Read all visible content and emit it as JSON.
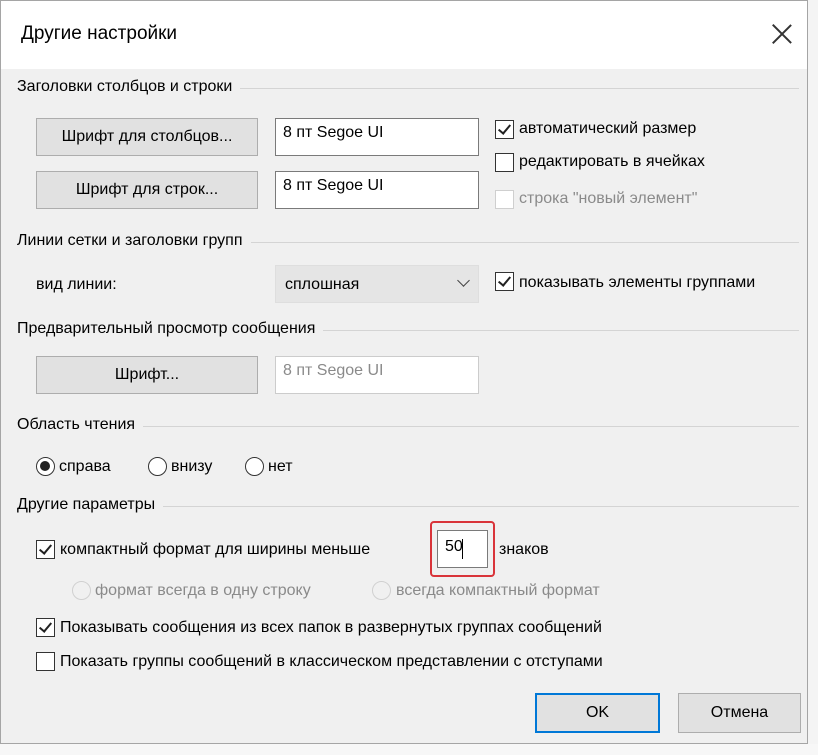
{
  "dialog": {
    "title": "Другие настройки",
    "close_icon": "close-icon"
  },
  "headers_group": {
    "label": "Заголовки столбцов и строки",
    "column_font_button": "Шрифт для столбцов...",
    "column_font_value": "8 пт Segoe UI",
    "row_font_button": "Шрифт для строк...",
    "row_font_value": "8 пт Segoe UI",
    "auto_size": {
      "label": "автоматический размер",
      "checked": true
    },
    "edit_in_cells": {
      "label": "редактировать в ячейках",
      "checked": false
    },
    "new_item_row": {
      "label": "строка \"новый элемент\"",
      "checked": false,
      "disabled": true
    }
  },
  "grid_group": {
    "label": "Линии сетки и заголовки групп",
    "line_style_label": "вид линии:",
    "line_style_value": "сплошная",
    "show_grouped": {
      "label": "показывать элементы группами",
      "checked": true
    }
  },
  "preview_group": {
    "label": "Предварительный просмотр сообщения",
    "font_button": "Шрифт...",
    "font_value": "8 пт Segoe UI"
  },
  "reading_pane_group": {
    "label": "Область чтения",
    "options": [
      {
        "label": "справа",
        "selected": true
      },
      {
        "label": "внизу",
        "selected": false
      },
      {
        "label": "нет",
        "selected": false
      }
    ]
  },
  "other_group": {
    "label": "Другие параметры",
    "compact": {
      "label": "компактный формат для ширины меньше",
      "checked": true,
      "value": "50",
      "suffix": "знаков"
    },
    "compact_options": [
      {
        "label": "формат всегда в одну строку",
        "disabled": true
      },
      {
        "label": "всегда компактный формат",
        "disabled": true
      }
    ],
    "show_all_folders": {
      "label": "Показывать сообщения из всех папок в развернутых группах сообщений",
      "checked": true
    },
    "classic_groups": {
      "label": "Показать группы сообщений в классическом представлении с отступами",
      "checked": false
    }
  },
  "footer": {
    "ok_label": "OK",
    "cancel_label": "Отмена"
  },
  "colors": {
    "dialog_bg": "#f0f0f0",
    "accent": "#0078d7",
    "highlight": "#d9343a"
  }
}
